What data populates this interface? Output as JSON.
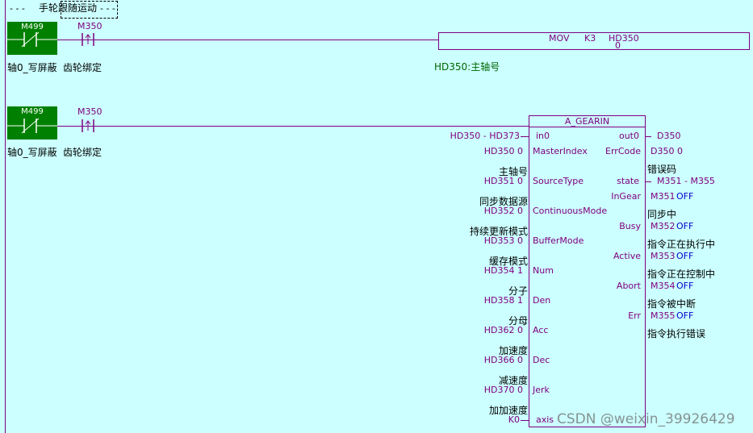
{
  "comment_title": "手轮跟随运动",
  "rung1": {
    "nc_contact": "M499",
    "nc_label": "轴0_写屏蔽",
    "pulse_contact": "M350",
    "pulse_label": "齿轮绑定",
    "instruction": {
      "op": "MOV",
      "src": "K3",
      "dst": "HD350",
      "dst_value": "0"
    },
    "dst_comment": "HD350:主轴号"
  },
  "rung2": {
    "nc_contact": "M499",
    "nc_label": "轴0_写屏蔽",
    "pulse_contact": "M350",
    "pulse_label": "齿轮绑定",
    "block_title": "A_GEARIN",
    "inputs": [
      {
        "pin": "in0",
        "operand": "HD350 - HD373",
        "comment": ""
      },
      {
        "pin": "MasterIndex",
        "operand": "HD350 0",
        "comment": "主轴号"
      },
      {
        "pin": "SourceType",
        "operand": "HD351 0",
        "comment": "同步数据源"
      },
      {
        "pin": "ContinuousMode",
        "operand": "HD352 0",
        "comment": "持续更新模式"
      },
      {
        "pin": "BufferMode",
        "operand": "HD353 0",
        "comment": "缓存模式"
      },
      {
        "pin": "Num",
        "operand": "HD354 1",
        "comment": "分子"
      },
      {
        "pin": "Den",
        "operand": "HD358 1",
        "comment": "分母"
      },
      {
        "pin": "Acc",
        "operand": "HD362 0",
        "comment": "加速度"
      },
      {
        "pin": "Dec",
        "operand": "HD366 0",
        "comment": "减速度"
      },
      {
        "pin": "Jerk",
        "operand": "HD370 0",
        "comment": "加加速度"
      },
      {
        "pin": "axis",
        "operand": "K0",
        "comment": ""
      }
    ],
    "outputs": [
      {
        "pin": "out0",
        "operand": "D350",
        "state": "",
        "comment": ""
      },
      {
        "pin": "ErrCode",
        "operand": "D350 0",
        "state": "",
        "comment": "错误码"
      },
      {
        "pin": "state",
        "operand": "M351 - M355",
        "state": "",
        "comment": ""
      },
      {
        "pin": "InGear",
        "operand": "M351",
        "state": "OFF",
        "comment": "同步中"
      },
      {
        "pin": "Busy",
        "operand": "M352",
        "state": "OFF",
        "comment": "指令正在执行中"
      },
      {
        "pin": "Active",
        "operand": "M353",
        "state": "OFF",
        "comment": "指令正在控制中"
      },
      {
        "pin": "Abort",
        "operand": "M354",
        "state": "OFF",
        "comment": "指令被中断"
      },
      {
        "pin": "Err",
        "operand": "M355",
        "state": "OFF",
        "comment": "指令执行错误"
      }
    ]
  },
  "watermark": "CSDN @weixin_39926429"
}
